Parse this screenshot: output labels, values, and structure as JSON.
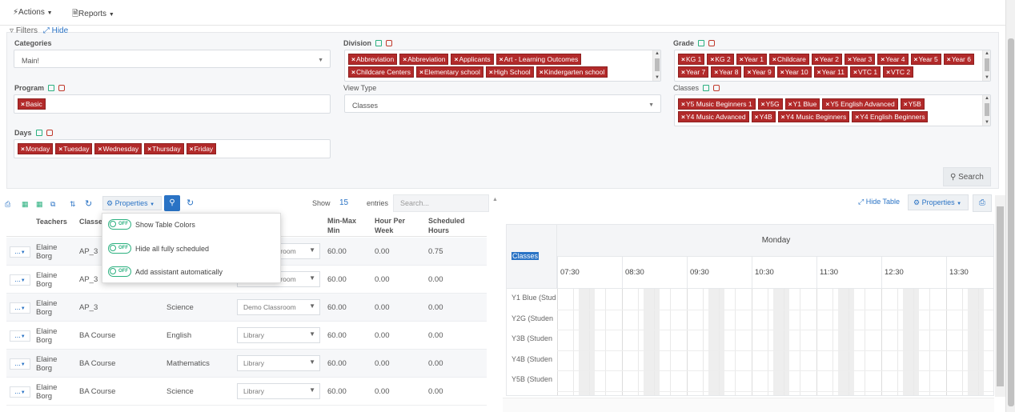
{
  "topbar": {
    "actions": "Actions",
    "reports": "Reports"
  },
  "filters": {
    "title": "Filters",
    "hide": "Hide",
    "categories": {
      "label": "Categories",
      "value": "Main!"
    },
    "division": {
      "label": "Division",
      "tags": [
        "Abbreviation",
        "Abbreviation",
        "Applicants",
        "Art - Learning Outcomes",
        "Childcare Centers",
        "Elementary school",
        "High School",
        "Kindergarten school"
      ]
    },
    "grade": {
      "label": "Grade",
      "tags": [
        "KG 1",
        "KG 2",
        "Year 1",
        "Childcare",
        "Year 2",
        "Year 3",
        "Year 4",
        "Year 5",
        "Year 6",
        "Year 7",
        "Year 8",
        "Year 9",
        "Year 10",
        "Year 11",
        "VTC 1",
        "VTC 2"
      ]
    },
    "program": {
      "label": "Program",
      "tags": [
        "Basic"
      ]
    },
    "view_type": {
      "label": "View Type",
      "value": "Classes"
    },
    "classes": {
      "label": "Classes",
      "tags": [
        "Y5 Music Beginners 1",
        "Y5G",
        "Y1 Blue",
        "Y5 English Advanced",
        "Y5B",
        "Y4 Music Advanced",
        "Y4B",
        "Y4 Music Beginners",
        "Y4 English Beginners"
      ]
    },
    "days": {
      "label": "Days",
      "tags": [
        "Monday",
        "Tuesday",
        "Wednesday",
        "Thursday",
        "Friday"
      ]
    },
    "search_btn": "Search"
  },
  "table_toolbar": {
    "properties": "Properties",
    "show": "Show",
    "entries_count": "15",
    "entries": "entries",
    "search_placeholder": "Search..."
  },
  "popup": {
    "items": [
      "Show Table Colors",
      "Hide all fully scheduled",
      "Add assistant automatically"
    ],
    "toggle_text": "OFF"
  },
  "table": {
    "headers": [
      "Teachers",
      "Classes",
      "Min-Max Min",
      "Hour Per Week",
      "Scheduled Hours"
    ],
    "rows": [
      {
        "teacher": "Elaine Borg",
        "class": "AP_3",
        "subject": "",
        "room": "Demo Classroom",
        "minmax": "60.00",
        "hpw": "0.00",
        "sched": "0.75"
      },
      {
        "teacher": "Elaine Borg",
        "class": "AP_3",
        "subject": "",
        "room": "Demo Classroom",
        "minmax": "60.00",
        "hpw": "0.00",
        "sched": "0.00"
      },
      {
        "teacher": "Elaine Borg",
        "class": "AP_3",
        "subject": "Science",
        "room": "Demo Classroom",
        "minmax": "60.00",
        "hpw": "0.00",
        "sched": "0.00"
      },
      {
        "teacher": "Elaine Borg",
        "class": "BA Course",
        "subject": "English",
        "room": "Library",
        "minmax": "60.00",
        "hpw": "0.00",
        "sched": "0.00"
      },
      {
        "teacher": "Elaine Borg",
        "class": "BA Course",
        "subject": "Mathematics",
        "room": "Library",
        "minmax": "60.00",
        "hpw": "0.00",
        "sched": "0.00"
      },
      {
        "teacher": "Elaine Borg",
        "class": "BA Course",
        "subject": "Science",
        "room": "Library",
        "minmax": "60.00",
        "hpw": "0.00",
        "sched": "0.00"
      }
    ],
    "row_btn": "..."
  },
  "schedule": {
    "hide_table": "Hide Table",
    "properties": "Properties",
    "classes_label": "Classes",
    "day": "Monday",
    "times": [
      "07:30",
      "08:30",
      "09:30",
      "10:30",
      "11:30",
      "12:30",
      "13:30"
    ],
    "rows": [
      "Y1 Blue (Stud",
      "Y2G (Studen",
      "Y3B (Studen",
      "Y4B (Studen",
      "Y5B (Studen"
    ]
  },
  "colors": {
    "accent": "#2a73c5",
    "tag": "#b22a2a",
    "toggle": "#2bb07f"
  }
}
